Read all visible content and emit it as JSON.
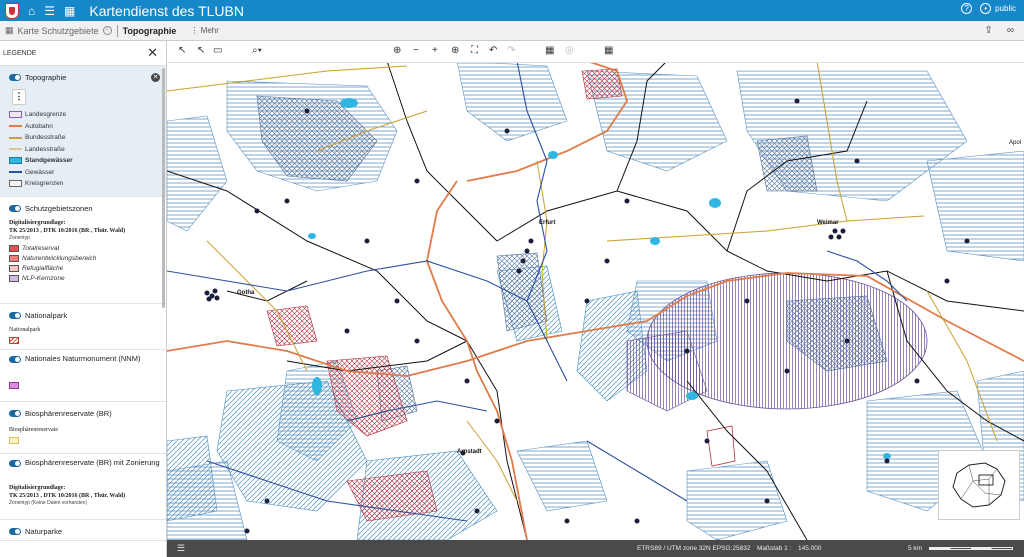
{
  "header": {
    "title": "Kartendienst des TLUBN",
    "user": "public"
  },
  "toolbar": {
    "breadcrumb_root": "Karte Schutzgebiete",
    "current_map": "Topographie",
    "more_label": "Mehr"
  },
  "legend": {
    "title": "LEGENDE",
    "topographie": {
      "label": "Topographie",
      "items": [
        {
          "label": "Landesgrenze",
          "style": "box",
          "color": "#8a5fb0"
        },
        {
          "label": "Autobahn",
          "style": "line",
          "color": "#e07b4a"
        },
        {
          "label": "Bundesstraße",
          "style": "line",
          "color": "#c8a030"
        },
        {
          "label": "Landesstraße",
          "style": "line",
          "color": "#d8c79a"
        },
        {
          "label": "Standgewässer",
          "style": "fill",
          "color": "#2fb6e3"
        },
        {
          "label": "Gewässer",
          "style": "line",
          "color": "#2c4f9e"
        },
        {
          "label": "Kreisgrenzen",
          "style": "box",
          "color": "#666666"
        }
      ]
    },
    "schutzgebietszonen": {
      "label": "Schutzgebietszonen",
      "source_title": "Digitalisiergrundlage:",
      "source_line": "TK 25/2013 , DTK 10/2016 (BR , Thür. Wald)",
      "zonentyp_label": "Zonentyp",
      "items": [
        {
          "label": "Totalreservat",
          "color": "#e85050"
        },
        {
          "label": "Naturentwicklungsbereich",
          "color": "#f08080"
        },
        {
          "label": "Refugialfläche",
          "color": "#f6c4c4"
        },
        {
          "label": "NLP-Kernzone",
          "color": "#d4b8e6"
        }
      ]
    },
    "nationalpark": {
      "label": "Nationalpark",
      "sub": "Nationalpark"
    },
    "nnm": {
      "label": "Nationales Naturmonument (NNM)"
    },
    "br": {
      "label": "Biosphärenreservate (BR)",
      "sub": "Biosphärenreservate"
    },
    "br_zonen": {
      "label": "Biosphärenreservate (BR) mit Zonierung",
      "source_title": "Digitalisiergrundlage:",
      "source_line": "TK 25/2013 , DTK 10/2016 (BR , Thür. Wald)",
      "zonentyp_label": "Zonentyp (Keine Daten vorhanden)"
    },
    "naturparke": {
      "label": "Naturparke"
    }
  },
  "map": {
    "cities": [
      {
        "name": "Erfurt"
      },
      {
        "name": "Gotha"
      },
      {
        "name": "Weimar"
      },
      {
        "name": "Arnstadt"
      },
      {
        "name": "Apol"
      }
    ]
  },
  "status": {
    "crs": "ETRS89 / UTM zone 32N EPSG:25832",
    "scale_label": "Maßstab 1 :",
    "scale_value": "145.000",
    "scalebar": "5 km"
  },
  "colors": {
    "header": "#1687c8",
    "hatch_blue": "#5b93c6",
    "hatch_purple": "#6a4f9a",
    "water": "#2fb6e3",
    "river": "#2c4f9e",
    "autobahn": "#e07b4a",
    "road": "#c8a030"
  }
}
